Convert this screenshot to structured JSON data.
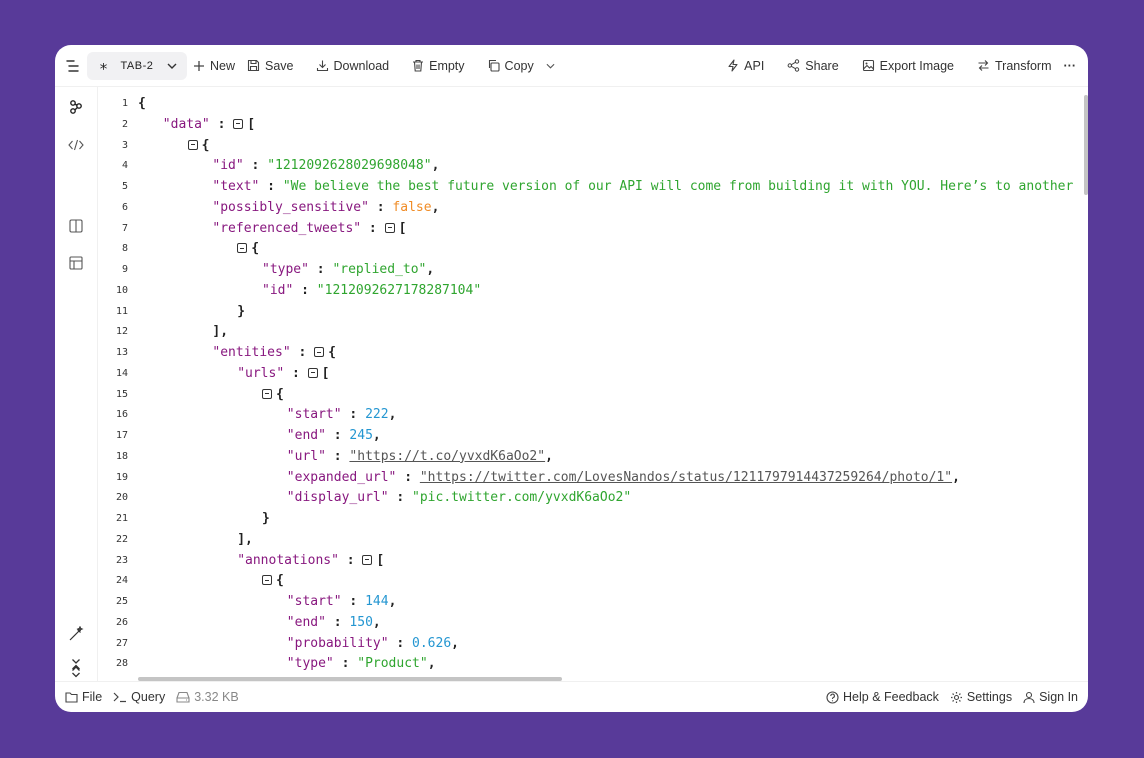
{
  "toolbar": {
    "tab_label": "TAB-2",
    "tab_glyph": "∗",
    "new_label": "New",
    "save_label": "Save",
    "download_label": "Download",
    "empty_label": "Empty",
    "copy_label": "Copy",
    "api_label": "API",
    "share_label": "Share",
    "export_label": "Export Image",
    "transform_label": "Transform",
    "more_label": "···"
  },
  "editor": {
    "lines": [
      [
        [
          "p",
          "{"
        ]
      ],
      [
        [
          "k",
          "\"data\""
        ],
        [
          "p",
          " : "
        ],
        [
          "f",
          ""
        ],
        [
          "p",
          "["
        ]
      ],
      [
        [
          "f",
          ""
        ],
        [
          "p",
          "{"
        ]
      ],
      [
        [
          "k",
          "\"id\""
        ],
        [
          "p",
          " : "
        ],
        [
          "s",
          "\"1212092628029698048\""
        ],
        [
          "p",
          ","
        ]
      ],
      [
        [
          "k",
          "\"text\""
        ],
        [
          "p",
          " : "
        ],
        [
          "s",
          "\"We believe the best future version of our API will come from building it with YOU. Here’s to another"
        ]
      ],
      [
        [
          "k",
          "\"possibly_sensitive\""
        ],
        [
          "p",
          " : "
        ],
        [
          "b",
          "false"
        ],
        [
          "p",
          ","
        ]
      ],
      [
        [
          "k",
          "\"referenced_tweets\""
        ],
        [
          "p",
          " : "
        ],
        [
          "f",
          ""
        ],
        [
          "p",
          "["
        ]
      ],
      [
        [
          "f",
          ""
        ],
        [
          "p",
          "{"
        ]
      ],
      [
        [
          "k",
          "\"type\""
        ],
        [
          "p",
          " : "
        ],
        [
          "s",
          "\"replied_to\""
        ],
        [
          "p",
          ","
        ]
      ],
      [
        [
          "k",
          "\"id\""
        ],
        [
          "p",
          " : "
        ],
        [
          "s",
          "\"1212092627178287104\""
        ]
      ],
      [
        [
          "p",
          "}"
        ]
      ],
      [
        [
          "p",
          "],"
        ]
      ],
      [
        [
          "k",
          "\"entities\""
        ],
        [
          "p",
          " : "
        ],
        [
          "f",
          ""
        ],
        [
          "p",
          "{"
        ]
      ],
      [
        [
          "k",
          "\"urls\""
        ],
        [
          "p",
          " : "
        ],
        [
          "f",
          ""
        ],
        [
          "p",
          "["
        ]
      ],
      [
        [
          "f",
          ""
        ],
        [
          "p",
          "{"
        ]
      ],
      [
        [
          "k",
          "\"start\""
        ],
        [
          "p",
          " : "
        ],
        [
          "n",
          "222"
        ],
        [
          "p",
          ","
        ]
      ],
      [
        [
          "k",
          "\"end\""
        ],
        [
          "p",
          " : "
        ],
        [
          "n",
          "245"
        ],
        [
          "p",
          ","
        ]
      ],
      [
        [
          "k",
          "\"url\""
        ],
        [
          "p",
          " : "
        ],
        [
          "u",
          "\"https://t.co/yvxdK6aOo2\""
        ],
        [
          "p",
          ","
        ]
      ],
      [
        [
          "k",
          "\"expanded_url\""
        ],
        [
          "p",
          " : "
        ],
        [
          "u",
          "\"https://twitter.com/LovesNandos/status/1211797914437259264/photo/1\""
        ],
        [
          "p",
          ","
        ]
      ],
      [
        [
          "k",
          "\"display_url\""
        ],
        [
          "p",
          " : "
        ],
        [
          "s",
          "\"pic.twitter.com/yvxdK6aOo2\""
        ]
      ],
      [
        [
          "p",
          "}"
        ]
      ],
      [
        [
          "p",
          "],"
        ]
      ],
      [
        [
          "k",
          "\"annotations\""
        ],
        [
          "p",
          " : "
        ],
        [
          "f",
          ""
        ],
        [
          "p",
          "["
        ]
      ],
      [
        [
          "f",
          ""
        ],
        [
          "p",
          "{"
        ]
      ],
      [
        [
          "k",
          "\"start\""
        ],
        [
          "p",
          " : "
        ],
        [
          "n",
          "144"
        ],
        [
          "p",
          ","
        ]
      ],
      [
        [
          "k",
          "\"end\""
        ],
        [
          "p",
          " : "
        ],
        [
          "n",
          "150"
        ],
        [
          "p",
          ","
        ]
      ],
      [
        [
          "k",
          "\"probability\""
        ],
        [
          "p",
          " : "
        ],
        [
          "n",
          "0.626"
        ],
        [
          "p",
          ","
        ]
      ],
      [
        [
          "k",
          "\"type\""
        ],
        [
          "p",
          " : "
        ],
        [
          "s",
          "\"Product\""
        ],
        [
          "p",
          ","
        ]
      ]
    ]
  },
  "statusbar": {
    "file_label": "File",
    "query_label": "Query",
    "size_label": "3.32 KB",
    "help_label": "Help & Feedback",
    "settings_label": "Settings",
    "signin_label": "Sign In"
  },
  "icons": [
    "menu-icon",
    "chevron-down-icon",
    "plus-icon",
    "save-icon",
    "download-icon",
    "trash-icon",
    "copy-icon",
    "bolt-icon",
    "share-icon",
    "image-icon",
    "transform-icon",
    "more-icon",
    "tree-icon",
    "code-icon",
    "split-icon",
    "table-icon",
    "wand-icon",
    "expand-icon",
    "collapse-icon",
    "folder-icon",
    "terminal-icon",
    "disk-icon",
    "help-icon",
    "gear-icon",
    "user-icon"
  ],
  "colors": {
    "background": "#583a99",
    "key": "#88187f",
    "string": "#2fa52f",
    "number": "#2496d1",
    "boolean": "#f08c26"
  }
}
